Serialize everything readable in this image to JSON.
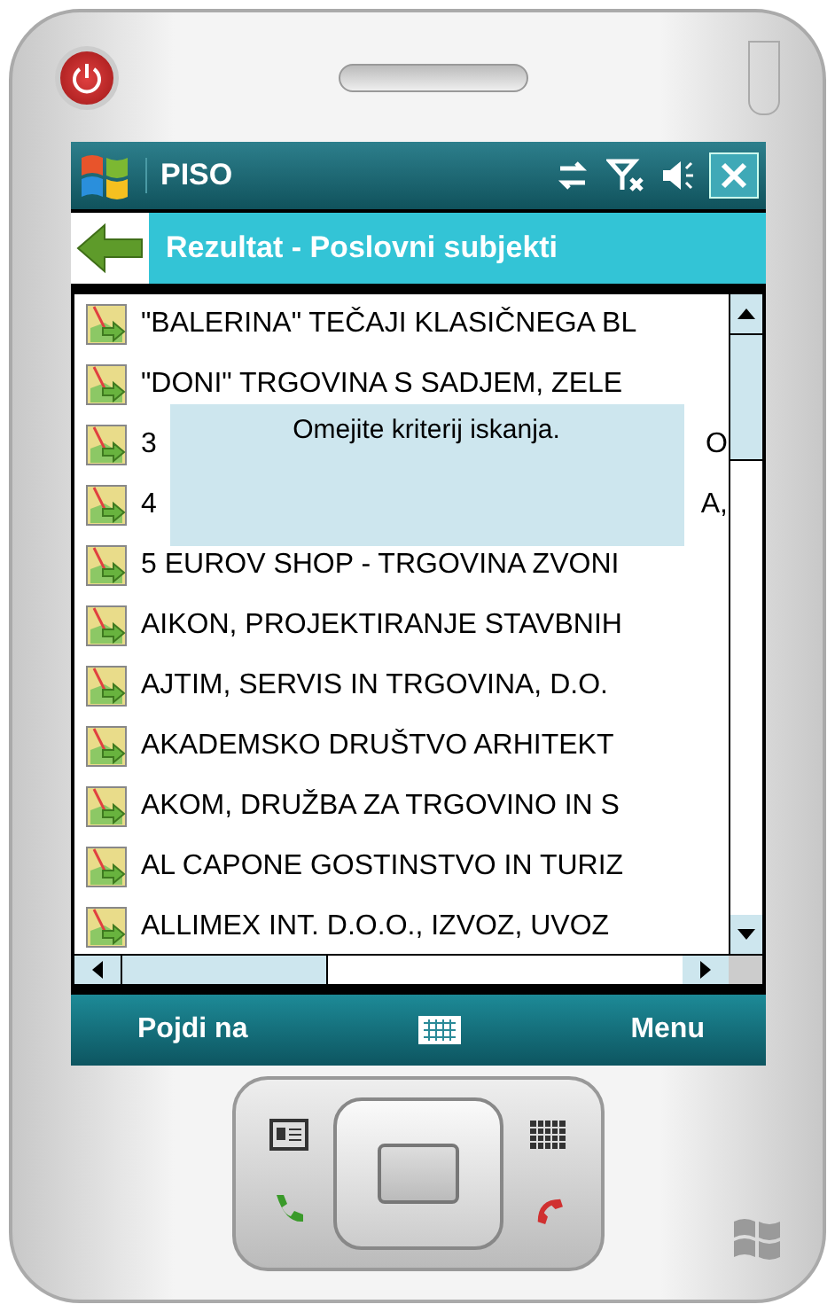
{
  "title_bar": {
    "app_name": "PISO"
  },
  "header": {
    "title": "Rezultat - Poslovni subjekti"
  },
  "rows": [
    {
      "kind": "full",
      "text": "\"BALERINA\" TEČAJI KLASIČNEGA BL"
    },
    {
      "kind": "full",
      "text": "\"DONI\" TRGOVINA S SADJEM, ZELE"
    },
    {
      "kind": "covered",
      "start": "3",
      "end": "O"
    },
    {
      "kind": "covered",
      "start": "4",
      "end": "A,"
    },
    {
      "kind": "full",
      "text": "5 EUROV SHOP - TRGOVINA ZVONI"
    },
    {
      "kind": "full",
      "text": "AIKON, PROJEKTIRANJE STAVBNIH"
    },
    {
      "kind": "full",
      "text": "AJTIM, SERVIS IN TRGOVINA, D.O."
    },
    {
      "kind": "full",
      "text": "AKADEMSKO DRUŠTVO ARHITEKT"
    },
    {
      "kind": "full",
      "text": "AKOM, DRUŽBA ZA TRGOVINO IN S"
    },
    {
      "kind": "full",
      "text": "AL CAPONE GOSTINSTVO IN TURIZ"
    },
    {
      "kind": "full",
      "text": "ALLIMEX INT. D.O.O., IZVOZ, UVOZ"
    }
  ],
  "popup": {
    "message": "Omejite kriterij iskanja."
  },
  "softkeys": {
    "left": "Pojdi na",
    "right": "Menu"
  }
}
